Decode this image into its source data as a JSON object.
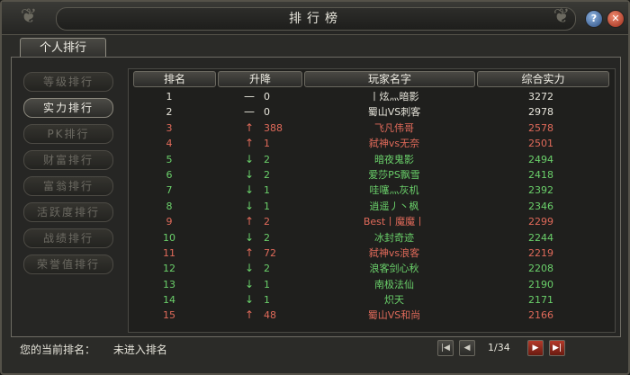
{
  "window": {
    "title": "排行榜"
  },
  "tab": {
    "label": "个人排行"
  },
  "sidebar": {
    "items": [
      {
        "label": "等级排行",
        "active": false
      },
      {
        "label": "实力排行",
        "active": true
      },
      {
        "label": "PK排行",
        "active": false
      },
      {
        "label": "财富排行",
        "active": false
      },
      {
        "label": "富翁排行",
        "active": false
      },
      {
        "label": "活跃度排行",
        "active": false
      },
      {
        "label": "战绩排行",
        "active": false
      },
      {
        "label": "荣誉值排行",
        "active": false
      }
    ]
  },
  "table": {
    "headers": [
      "排名",
      "升降",
      "玩家名字",
      "综合实力"
    ],
    "rows": [
      {
        "rank": "1",
        "dir": "—",
        "change": "0",
        "name": "丨炫灬暗影",
        "power": "3272",
        "color": "#e8e6dc"
      },
      {
        "rank": "2",
        "dir": "—",
        "change": "0",
        "name": "蜀山VS刺客",
        "power": "2978",
        "color": "#e8e6dc"
      },
      {
        "rank": "3",
        "dir": "↑",
        "change": "388",
        "name": "飞凡伟哥",
        "power": "2578",
        "color": "#e06a5a"
      },
      {
        "rank": "4",
        "dir": "↑",
        "change": "1",
        "name": "弑神vs无奈",
        "power": "2501",
        "color": "#e06a5a"
      },
      {
        "rank": "5",
        "dir": "↓",
        "change": "2",
        "name": "暗夜鬼影",
        "power": "2494",
        "color": "#6ad06a"
      },
      {
        "rank": "6",
        "dir": "↓",
        "change": "2",
        "name": "爱莎PS飘雪",
        "power": "2418",
        "color": "#6ad06a"
      },
      {
        "rank": "7",
        "dir": "↓",
        "change": "1",
        "name": "哇噻灬灰机",
        "power": "2392",
        "color": "#6ad06a"
      },
      {
        "rank": "8",
        "dir": "↓",
        "change": "1",
        "name": "逍遥丿丶枫",
        "power": "2346",
        "color": "#6ad06a"
      },
      {
        "rank": "9",
        "dir": "↑",
        "change": "2",
        "name": "Best丨魔魔丨",
        "power": "2299",
        "color": "#e06a5a"
      },
      {
        "rank": "10",
        "dir": "↓",
        "change": "2",
        "name": "冰封奇迹",
        "power": "2244",
        "color": "#6ad06a"
      },
      {
        "rank": "11",
        "dir": "↑",
        "change": "72",
        "name": "弑神vs浪客",
        "power": "2219",
        "color": "#e06a5a"
      },
      {
        "rank": "12",
        "dir": "↓",
        "change": "2",
        "name": "浪客剑心秋",
        "power": "2208",
        "color": "#6ad06a"
      },
      {
        "rank": "13",
        "dir": "↓",
        "change": "1",
        "name": "南极法仙",
        "power": "2190",
        "color": "#6ad06a"
      },
      {
        "rank": "14",
        "dir": "↓",
        "change": "1",
        "name": "炽天",
        "power": "2171",
        "color": "#6ad06a"
      },
      {
        "rank": "15",
        "dir": "↑",
        "change": "48",
        "name": "蜀山VS和尚",
        "power": "2166",
        "color": "#e06a5a"
      }
    ]
  },
  "footer": {
    "label": "您的当前排名：",
    "value": "未进入排名"
  },
  "pager": {
    "page": "1/34"
  },
  "colors": {
    "up_arrow": "#e06a5a",
    "down_arrow": "#6ad06a",
    "neutral": "#e8e6dc"
  }
}
